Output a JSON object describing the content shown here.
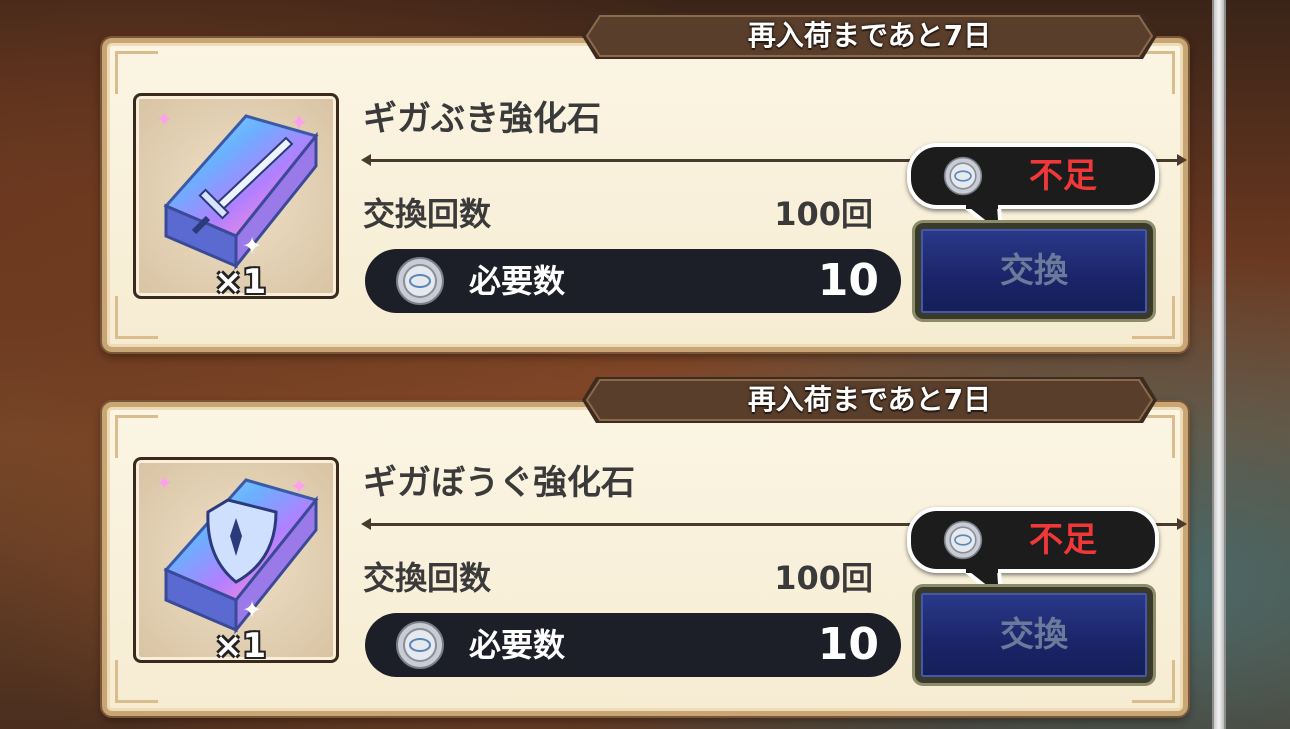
{
  "offers": [
    {
      "restock_text": "再入荷まであと7日",
      "item_name": "ギガぶき強化石",
      "quantity": "×1",
      "exchange_count_label": "交換回数",
      "exchange_count_value": "100回",
      "required_label": "必要数",
      "required_value": "10",
      "shortage_text": "不足",
      "exchange_button_label": "交換",
      "item_icon": "sword-stone-icon"
    },
    {
      "restock_text": "再入荷まであと7日",
      "item_name": "ギガぼうぐ強化石",
      "quantity": "×1",
      "exchange_count_label": "交換回数",
      "exchange_count_value": "100回",
      "required_label": "必要数",
      "required_value": "10",
      "shortage_text": "不足",
      "exchange_button_label": "交換",
      "item_icon": "shield-stone-icon"
    }
  ],
  "colors": {
    "card_bg": "#f8efd8",
    "card_border": "#c8a574",
    "banner_bg": "#5a3e2c",
    "shortage_red": "#f03838",
    "button_blue": "#1a2468"
  }
}
